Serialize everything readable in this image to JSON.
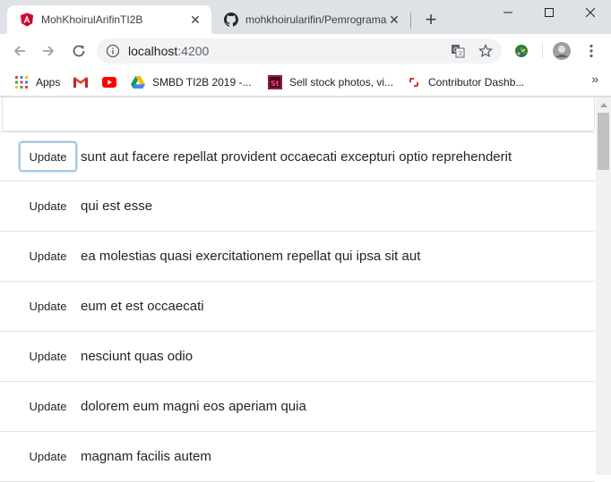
{
  "browser": {
    "tabs": [
      {
        "title": "MohKhoirulArifinTI2B",
        "favicon": "angular-icon",
        "active": true
      },
      {
        "title": "mohkhoirularifin/Pemrograma",
        "favicon": "github-icon",
        "active": false
      }
    ],
    "url_host": "localhost",
    "url_port": ":4200",
    "bookmarks": [
      {
        "label": "Apps",
        "icon": "apps-grid-icon"
      },
      {
        "label": "",
        "icon": "gmail-icon"
      },
      {
        "label": "",
        "icon": "youtube-icon"
      },
      {
        "label": "SMBD TI2B 2019 -...",
        "icon": "google-drive-icon"
      },
      {
        "label": "Sell stock photos, vi...",
        "icon": "adobe-stock-icon"
      },
      {
        "label": "Contributor Dashb...",
        "icon": "shutterstock-icon"
      }
    ]
  },
  "list": {
    "button_label": "Update",
    "items": [
      "sunt aut facere repellat provident occaecati excepturi optio reprehenderit",
      "qui est esse",
      "ea molestias quasi exercitationem repellat qui ipsa sit aut",
      "eum et est occaecati",
      "nesciunt quas odio",
      "dolorem eum magni eos aperiam quia",
      "magnam facilis autem"
    ]
  },
  "colors": {
    "chrome_bg": "#dee1e6",
    "focus_ring": "#a6c8ea",
    "border": "#dee2e6"
  }
}
